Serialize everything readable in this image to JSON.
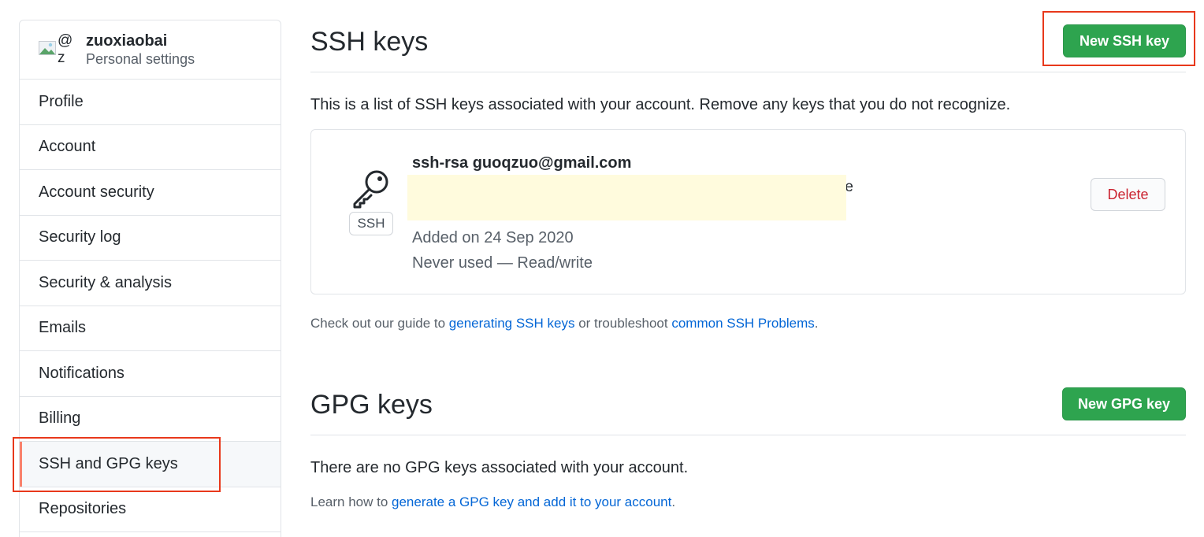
{
  "sidebar": {
    "username": "zuoxiaobai",
    "subtitle": "Personal settings",
    "avatar_alt_at": "@",
    "avatar_alt_z": "z",
    "items": [
      {
        "label": "Profile"
      },
      {
        "label": "Account"
      },
      {
        "label": "Account security"
      },
      {
        "label": "Security log"
      },
      {
        "label": "Security & analysis"
      },
      {
        "label": "Emails"
      },
      {
        "label": "Notifications"
      },
      {
        "label": "Billing"
      },
      {
        "label": "SSH and GPG keys"
      },
      {
        "label": "Repositories"
      }
    ],
    "selected": "SSH and GPG keys"
  },
  "ssh": {
    "title": "SSH keys",
    "new_button": "New SSH key",
    "intro": "This is a list of SSH keys associated with your account. Remove any keys that you do not recognize.",
    "key": {
      "badge": "SSH",
      "title": "ssh-rsa guoqzuo@gmail.com",
      "fingerprint_visible_tail": "e",
      "added": "Added on 24 Sep 2020",
      "usage": "Never used — Read/write",
      "delete_label": "Delete"
    },
    "guide": {
      "prefix": "Check out our guide to ",
      "link1": "generating SSH keys",
      "middle": " or troubleshoot ",
      "link2": "common SSH Problems",
      "suffix": "."
    }
  },
  "gpg": {
    "title": "GPG keys",
    "new_button": "New GPG key",
    "empty": "There are no GPG keys associated with your account.",
    "learn": {
      "prefix": "Learn how to ",
      "link": "generate a GPG key and add it to your account",
      "suffix": "."
    }
  },
  "colors": {
    "primary_green": "#2ea44f",
    "danger_red": "#cb2431",
    "link_blue": "#0366d6",
    "highlight_outline": "#e8381b",
    "redaction": "#fffbdd",
    "selected_indicator": "#f9826c"
  }
}
